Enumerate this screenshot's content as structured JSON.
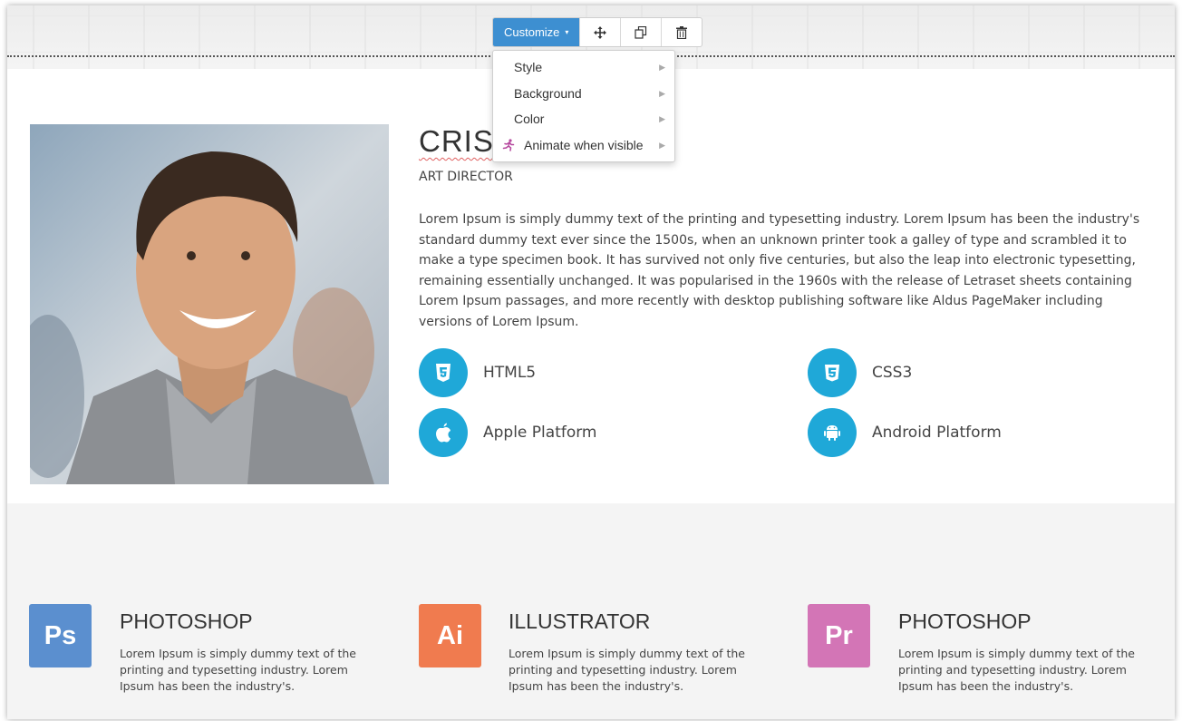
{
  "toolbar": {
    "customize_label": "Customize",
    "caret": "▾",
    "buttons": [
      "move-icon",
      "copy-icon",
      "trash-icon"
    ]
  },
  "dropdown": {
    "items": [
      {
        "label": "Style",
        "arrow": "▶"
      },
      {
        "label": "Background",
        "arrow": "▶"
      },
      {
        "label": "Color",
        "arrow": "▶"
      },
      {
        "label": "Animate when visible",
        "arrow": "▶",
        "icon": "running-person-icon"
      }
    ]
  },
  "profile": {
    "name": "CRIST",
    "role": "ART DIRECTOR",
    "bio": "Lorem Ipsum is simply dummy text of the printing and typesetting industry. Lorem Ipsum has been the industry's standard dummy text ever since the 1500s, when an unknown printer took a galley of type and scrambled it to make a type specimen book. It has survived not only five centuries, but also the leap into electronic typesetting, remaining essentially unchanged. It was popularised in the 1960s with the release of Letraset sheets containing Lorem Ipsum passages, and more recently with desktop publishing software like Aldus PageMaker including versions of Lorem Ipsum.",
    "skills": [
      {
        "label": "HTML5",
        "icon": "html5-icon"
      },
      {
        "label": "CSS3",
        "icon": "css3-icon"
      },
      {
        "label": "Apple Platform",
        "icon": "apple-icon"
      },
      {
        "label": "Android Platform",
        "icon": "android-icon"
      }
    ],
    "skill_color": "#1fa8d8"
  },
  "apps": [
    {
      "abbr": "Ps",
      "title": "PHOTOSHOP",
      "text": "Lorem Ipsum is simply dummy text of the printing and typesetting industry. Lorem Ipsum has been the industry's.",
      "color": "#5b8fcf"
    },
    {
      "abbr": "Ai",
      "title": "ILLUSTRATOR",
      "text": "Lorem Ipsum is simply dummy text of the printing and typesetting industry. Lorem Ipsum has been the industry's.",
      "color": "#f07b4f"
    },
    {
      "abbr": "Pr",
      "title": "PHOTOSHOP",
      "text": "Lorem Ipsum is simply dummy text of the printing and typesetting industry. Lorem Ipsum has been the industry's.",
      "color": "#d375b6"
    }
  ],
  "colors": {
    "accent": "#3d8fd1",
    "section_bg": "#f4f4f4"
  }
}
